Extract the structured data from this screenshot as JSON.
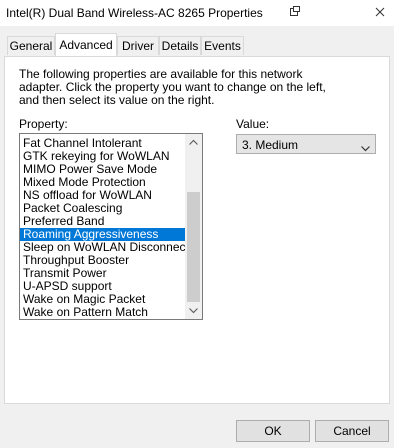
{
  "window": {
    "title": "Intel(R) Dual Band Wireless-AC 8265 Properties"
  },
  "tabs": [
    {
      "label": "General"
    },
    {
      "label": "Advanced",
      "active": true
    },
    {
      "label": "Driver"
    },
    {
      "label": "Details"
    },
    {
      "label": "Events"
    }
  ],
  "advanced": {
    "description": "The following properties are available for this network adapter. Click the property you want to change on the left, and then select its value on the right.",
    "property_label": "Property:",
    "value_label": "Value:",
    "properties": [
      "Fat Channel Intolerant",
      "GTK rekeying for WoWLAN",
      "MIMO Power Save Mode",
      "Mixed Mode Protection",
      "NS offload for WoWLAN",
      "Packet Coalescing",
      "Preferred Band",
      "Roaming Aggressiveness",
      "Sleep on WoWLAN Disconnect",
      "Throughput Booster",
      "Transmit Power",
      "U-APSD support",
      "Wake on Magic Packet",
      "Wake on Pattern Match"
    ],
    "selected_property": "Roaming Aggressiveness",
    "value": "3. Medium"
  },
  "buttons": {
    "ok": "OK",
    "cancel": "Cancel"
  },
  "colors": {
    "selection": "#0078d7",
    "window_bg": "#f0f0f0"
  },
  "icons": [
    "window-icon",
    "close-icon",
    "scroll-up-icon",
    "scroll-down-icon",
    "dropdown-chevron-icon"
  ]
}
